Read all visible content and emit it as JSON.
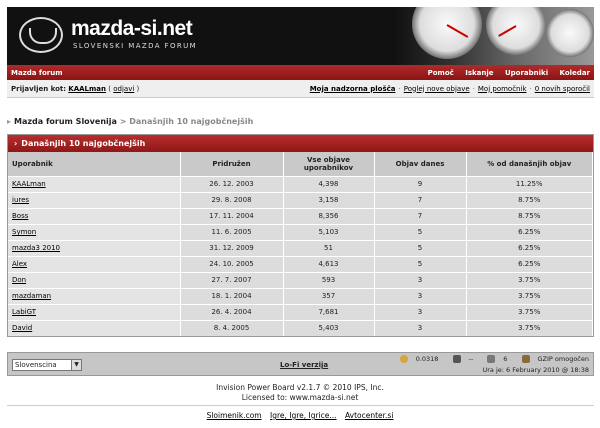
{
  "header": {
    "logo_text": "mazda-si.net",
    "logo_subtitle": "SLOVENSKI MAZDA FORUM"
  },
  "navbar": {
    "brand": "Mazda forum",
    "links": [
      "Pomoč",
      "Iskanje",
      "Uporabniki",
      "Koledar"
    ]
  },
  "userbar": {
    "logged_label": "Prijavljen kot:",
    "username": "KAALman",
    "logout": "odjavi",
    "control_panel": "Moja nadzorna plošča",
    "new_posts": "Poglej nove objave",
    "assistant": "Moj pomočnik",
    "messages": "0 novih sporočil"
  },
  "breadcrumb": {
    "root": "Mazda forum Slovenija",
    "separator": ">",
    "current": "Današnjih 10 najgobčnejših"
  },
  "panel": {
    "title": "Današnjih 10 najgobčnejših",
    "columns": [
      "Uporabnik",
      "Pridružen",
      "Vse objave uporabnikov",
      "Objav danes",
      "% od današnjih objav"
    ],
    "rows": [
      {
        "user": "KAALman",
        "joined": "26. 12. 2003",
        "posts": "4,398",
        "today": "9",
        "percent": "11.25%"
      },
      {
        "user": "iures",
        "joined": "29. 8. 2008",
        "posts": "3,158",
        "today": "7",
        "percent": "8.75%"
      },
      {
        "user": "Boss",
        "joined": "17. 11. 2004",
        "posts": "8,356",
        "today": "7",
        "percent": "8.75%"
      },
      {
        "user": "Symon",
        "joined": "11. 6. 2005",
        "posts": "5,103",
        "today": "5",
        "percent": "6.25%"
      },
      {
        "user": "mazda3 2010",
        "joined": "31. 12. 2009",
        "posts": "51",
        "today": "5",
        "percent": "6.25%"
      },
      {
        "user": "Alex",
        "joined": "24. 10. 2005",
        "posts": "4,613",
        "today": "5",
        "percent": "6.25%"
      },
      {
        "user": "Don",
        "joined": "27. 7. 2007",
        "posts": "593",
        "today": "3",
        "percent": "3.75%"
      },
      {
        "user": "mazdaman",
        "joined": "18. 1. 2004",
        "posts": "357",
        "today": "3",
        "percent": "3.75%"
      },
      {
        "user": "LabiGT",
        "joined": "26. 4. 2004",
        "posts": "7,681",
        "today": "3",
        "percent": "3.75%"
      },
      {
        "user": "David",
        "joined": "8. 4. 2005",
        "posts": "5,403",
        "today": "3",
        "percent": "3.75%"
      }
    ]
  },
  "footer": {
    "language": "Slovenscina",
    "lofi": "Lo-Fi verzija",
    "load_time": "0.0318",
    "queries": "--",
    "sql_count": "6",
    "gzip": "GZIP omogočen",
    "time": "Ura je: 6 February 2010 @ 18:38",
    "copyright_line1": "Invision Power Board v2.1.7 © 2010  IPS, Inc.",
    "copyright_line2": "Licensed to: www.mazda-si.net",
    "partners": [
      "Sloimenik.com",
      "Igre, Igre, Igrice...",
      "Avtocenter.si"
    ]
  },
  "colors": {
    "accent_red": "#9e1f1f",
    "header_bg": "#111111"
  }
}
